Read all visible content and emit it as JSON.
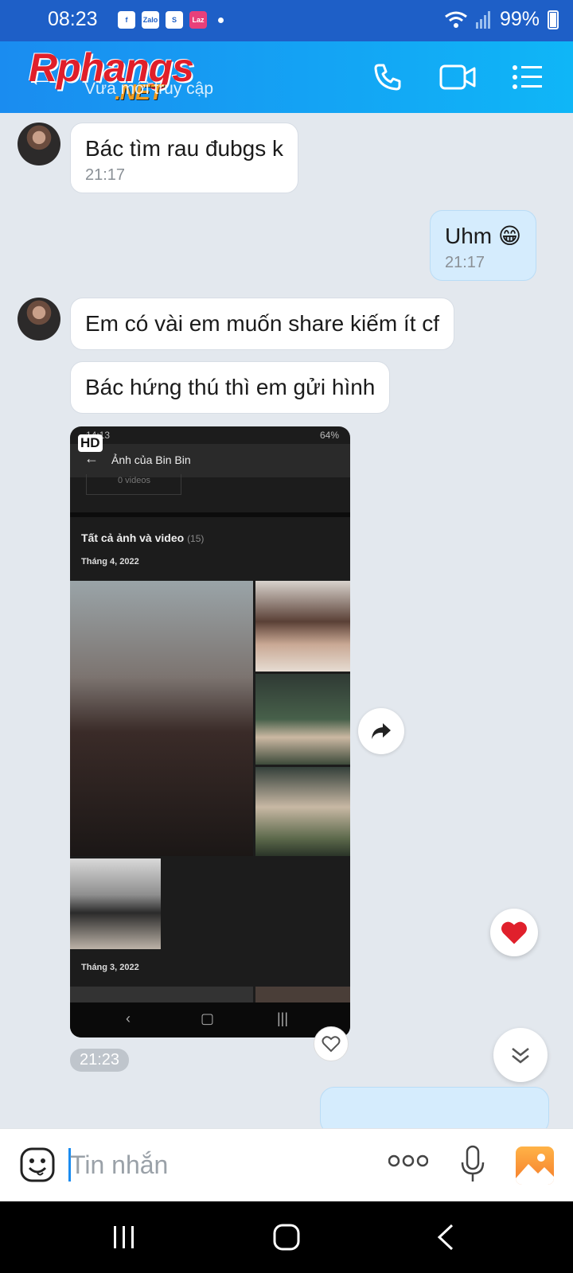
{
  "status_bar": {
    "time": "08:23",
    "notification_icons": [
      "facebook-icon",
      "zalo-icon",
      "shopee-icon",
      "lazada-icon"
    ],
    "zalo_label": "Zalo",
    "lazada_label": "Laz",
    "shopee_label": "S",
    "facebook_label": "f",
    "battery": "99%"
  },
  "header": {
    "watermark": "Rphangs",
    "watermark_suffix": ".NET",
    "subtitle": "Vừa mới truy cập",
    "accent_color": "#1a8cf0"
  },
  "messages": [
    {
      "side": "left",
      "text": "Bác tìm rau đubgs k",
      "time": "21:17"
    },
    {
      "side": "right",
      "text": "Uhm 😁",
      "time": "21:17"
    },
    {
      "side": "left",
      "text": "Em có vài em muốn share kiếm ít cf",
      "time": ""
    },
    {
      "side": "left",
      "text": "Bác hứng thú thì em gửi hình",
      "time": ""
    }
  ],
  "shared_image": {
    "badge": "HD",
    "inner_time": "14:13",
    "inner_battery": "64%",
    "inner_title": "Ảnh của Bin Bin",
    "inner_videos": "0 videos",
    "inner_all_label": "Tất cả ảnh và video",
    "inner_all_count": "(15)",
    "inner_month_1": "Tháng 4, 2022",
    "inner_month_2": "Tháng 3, 2022",
    "time": "21:23"
  },
  "input": {
    "placeholder": "Tin nhắn",
    "value": ""
  }
}
